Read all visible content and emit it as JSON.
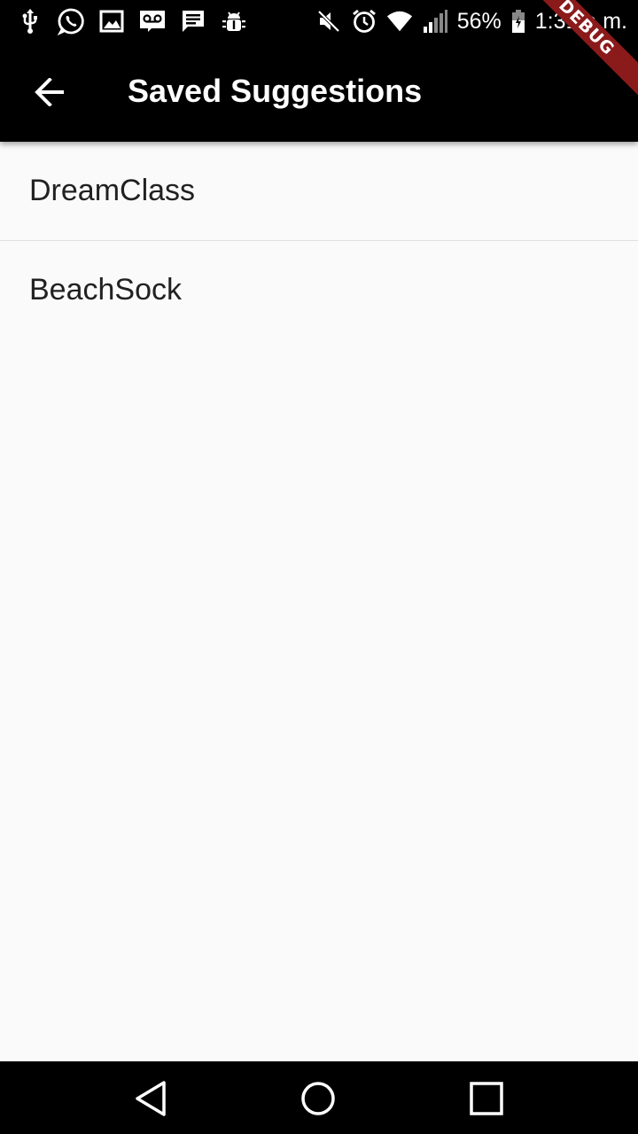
{
  "status_bar": {
    "left_icons": [
      "usb-icon",
      "whatsapp-icon",
      "image-icon",
      "voicemail-icon",
      "message-icon",
      "android-debug-icon"
    ],
    "right_icons": [
      "mute-icon",
      "alarm-icon",
      "wifi-icon",
      "signal-icon",
      "battery-icon"
    ],
    "battery_percent": "56%",
    "time": "1:31 a.m."
  },
  "app_bar": {
    "title": "Saved Suggestions",
    "back_icon": "arrow-back-icon"
  },
  "debug_banner": "DEBUG",
  "list": {
    "items": [
      {
        "label": "DreamClass"
      },
      {
        "label": "BeachSock"
      }
    ]
  },
  "nav_bar": {
    "buttons": [
      "back-triangle-icon",
      "home-circle-icon",
      "recents-square-icon"
    ]
  },
  "colors": {
    "app_bar_bg": "#000000",
    "background": "#fafafa",
    "text": "#212121",
    "debug_banner": "#8b1a1a"
  }
}
